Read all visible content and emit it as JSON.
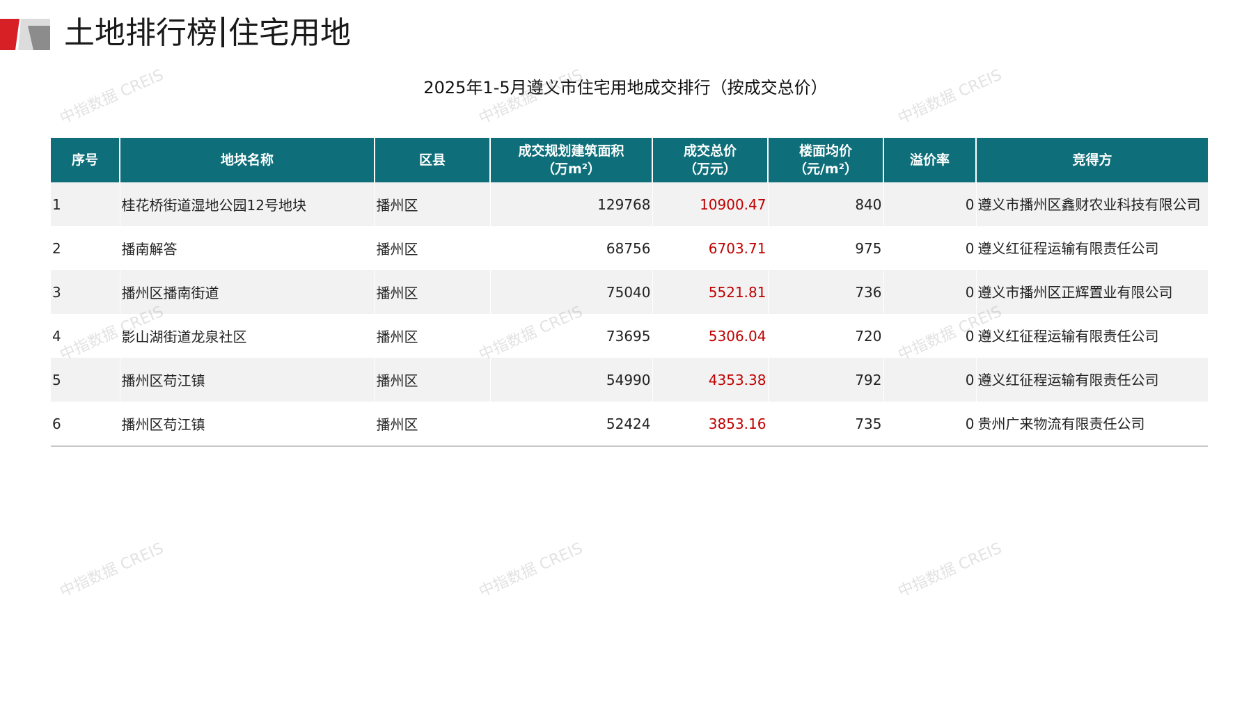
{
  "header": {
    "title_left": "土地排行榜",
    "title_right": "住宅用地"
  },
  "table_title": "2025年1-5月遵义市住宅用地成交排行（按成交总价）",
  "watermark": "中指数据 CREIS",
  "colors": {
    "header_bg": "#0e6e79",
    "price_text": "#c00000",
    "logo_red": "#d71f26",
    "logo_gray": "#9a9a9a"
  },
  "columns": [
    {
      "line1": "序号",
      "line2": ""
    },
    {
      "line1": "地块名称",
      "line2": ""
    },
    {
      "line1": "区县",
      "line2": ""
    },
    {
      "line1": "成交规划建筑面积",
      "line2": "（万m²）"
    },
    {
      "line1": "成交总价",
      "line2": "（万元）"
    },
    {
      "line1": "楼面均价",
      "line2": "（元/m²）"
    },
    {
      "line1": "溢价率",
      "line2": ""
    },
    {
      "line1": "竞得方",
      "line2": ""
    }
  ],
  "rows": [
    {
      "no": "1",
      "name": "桂花桥街道湿地公园12号地块",
      "district": "播州区",
      "area": "129768",
      "price": "10900.47",
      "unit_price": "840",
      "premium": "0",
      "winner": "遵义市播州区鑫财农业科技有限公司"
    },
    {
      "no": "2",
      "name": "播南解答",
      "district": "播州区",
      "area": "68756",
      "price": "6703.71",
      "unit_price": "975",
      "premium": "0",
      "winner": "遵义红征程运输有限责任公司"
    },
    {
      "no": "3",
      "name": "播州区播南街道",
      "district": "播州区",
      "area": "75040",
      "price": "5521.81",
      "unit_price": "736",
      "premium": "0",
      "winner": "遵义市播州区正辉置业有限公司"
    },
    {
      "no": "4",
      "name": "影山湖街道龙泉社区",
      "district": "播州区",
      "area": "73695",
      "price": "5306.04",
      "unit_price": "720",
      "premium": "0",
      "winner": "遵义红征程运输有限责任公司"
    },
    {
      "no": "5",
      "name": "播州区苟江镇",
      "district": "播州区",
      "area": "54990",
      "price": "4353.38",
      "unit_price": "792",
      "premium": "0",
      "winner": "遵义红征程运输有限责任公司"
    },
    {
      "no": "6",
      "name": "播州区苟江镇",
      "district": "播州区",
      "area": "52424",
      "price": "3853.16",
      "unit_price": "735",
      "premium": "0",
      "winner": "贵州广来物流有限责任公司"
    }
  ]
}
